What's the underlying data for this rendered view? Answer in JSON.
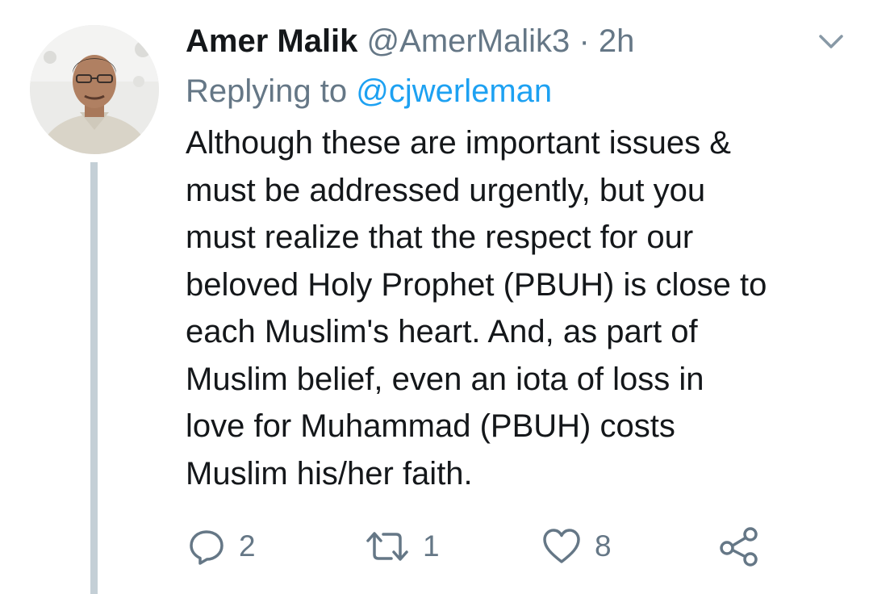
{
  "tweet": {
    "author_name": "Amer Malik",
    "author_handle": "@AmerMalik3",
    "separator": "·",
    "timestamp": "2h",
    "replying_prefix": "Replying to",
    "replying_handle": "@cjwerleman",
    "body_lines": [
      "Although these are important issues &",
      "must be addressed urgently, but you",
      "must realize that the respect for our",
      "beloved Holy Prophet (PBUH) is close to",
      "each Muslim's heart. And, as part of",
      "Muslim belief, even an iota of loss in",
      "love for Muhammad (PBUH) costs",
      "Muslim his/her faith."
    ]
  },
  "actions": {
    "reply_count": "2",
    "retweet_count": "1",
    "like_count": "8"
  },
  "icons": {
    "reply": "reply-icon",
    "retweet": "retweet-icon",
    "like": "heart-icon",
    "share": "share-icon",
    "menu": "chevron-down-icon"
  },
  "colors": {
    "name": "#14171a",
    "secondary": "#657786",
    "link": "#1da1f2",
    "thread_line": "#c4cfd6",
    "background": "#ffffff"
  }
}
